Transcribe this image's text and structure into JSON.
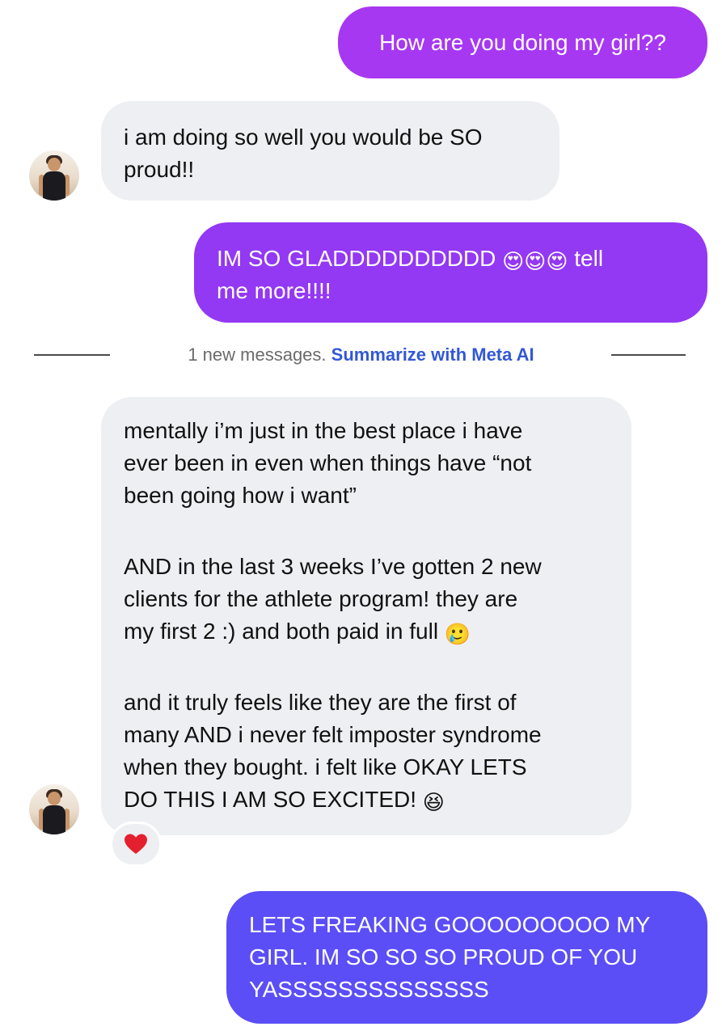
{
  "messages": {
    "m1": {
      "text": "How are you doing my girl??"
    },
    "m2": {
      "line1": "i am doing so well you would be SO",
      "line2": "proud!!"
    },
    "m3": {
      "line1_prefix": "IM SO GLADDDDDDDDDD",
      "emojis": [
        "😍",
        "😍",
        "😍"
      ],
      "line1_suffix": "tell",
      "line2": "me more!!!!"
    },
    "m4": {
      "p1": [
        "mentally i’m just in the best place i have",
        "ever been in even when things have “not",
        "been going how i want”"
      ],
      "p2": [
        "AND in the last 3 weeks I’ve gotten 2 new",
        "clients for the athlete program! they are"
      ],
      "p2_last": "my first 2 :) and both paid in full",
      "p2_emoji": "🥲",
      "p3": [
        "and it truly feels like they are the first of",
        "many AND i never felt imposter syndrome",
        "when they bought. i felt like OKAY LETS"
      ],
      "p3_last": "DO THIS I AM SO EXCITED!",
      "p3_emoji": "😆",
      "reaction": "❤️"
    },
    "m5": {
      "lines": [
        "LETS FREAKING GOOOOOOOOO MY",
        "GIRL. IM SO SO SO PROUD OF YOU",
        "YASSSSSSSSSSSSSS"
      ]
    }
  },
  "divider": {
    "count_text": "1 new messages.",
    "action_text": "Summarize with Meta AI"
  },
  "colors": {
    "outgoing_1": "#a336f2",
    "outgoing_2": "#8f38f3",
    "outgoing_3": "#5a4ef5",
    "incoming": "#eeeff3",
    "link": "#3358d4"
  }
}
